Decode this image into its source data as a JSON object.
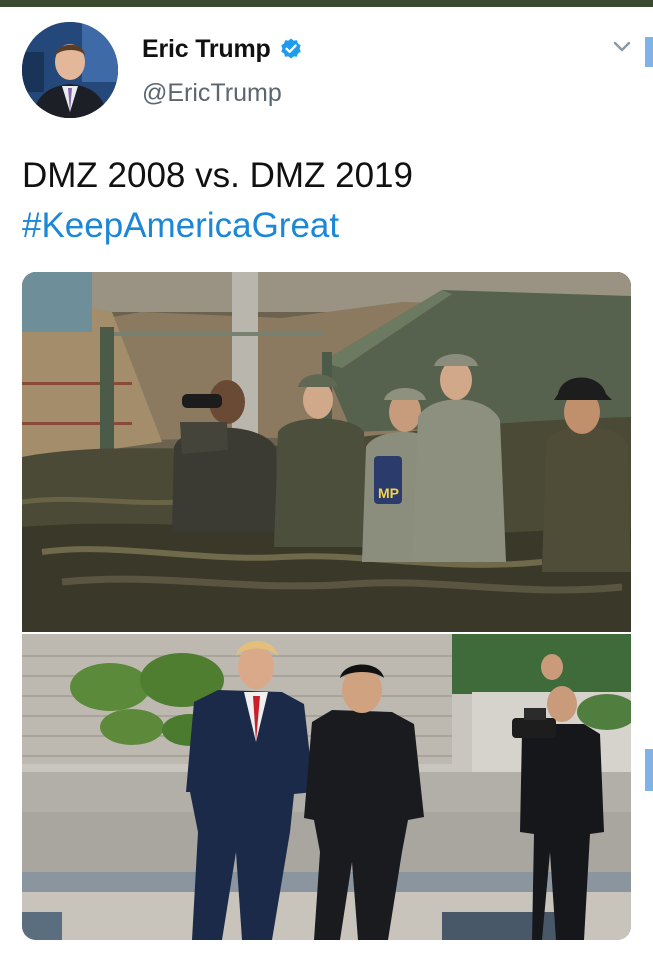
{
  "tweet": {
    "author": {
      "display_name": "Eric Trump",
      "handle": "@EricTrump",
      "verified": true,
      "verified_icon": "verified-badge-icon",
      "avatar": "profile-photo"
    },
    "menu_icon": "chevron-down-icon",
    "text_line_1": "DMZ 2008 vs. DMZ 2019",
    "hashtag": "#KeepAmericaGreat",
    "media": {
      "top_photo": "photo-dmz-2008",
      "bottom_photo": "photo-dmz-2019",
      "patch_text": "MP"
    }
  },
  "colors": {
    "hashtag": "#1b87d6",
    "verified": "#1d9bf0",
    "handle": "#5b6670",
    "top_bar": "#3a4a2f"
  }
}
